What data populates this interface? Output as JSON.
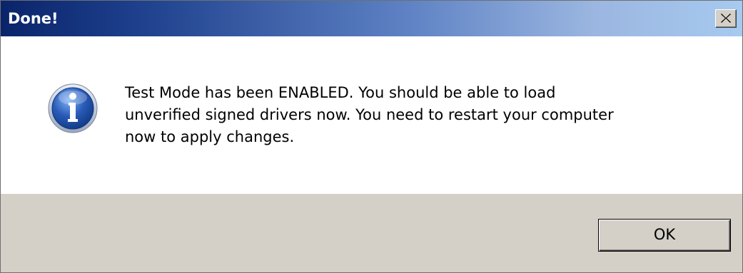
{
  "dialog": {
    "title": "Done!",
    "close_symbol": "×",
    "icon": "information-icon",
    "message_lines": [
      "Test Mode has been ENABLED. You should be able to load",
      "unverified signed drivers now. You need to restart your computer",
      "now to apply changes."
    ],
    "ok_label": "OK"
  },
  "colors": {
    "titlebar_start": "#0a246a",
    "titlebar_end": "#a6caf0",
    "footer_bg": "#d4d0c8",
    "icon_blue": "#2a5bb8"
  }
}
